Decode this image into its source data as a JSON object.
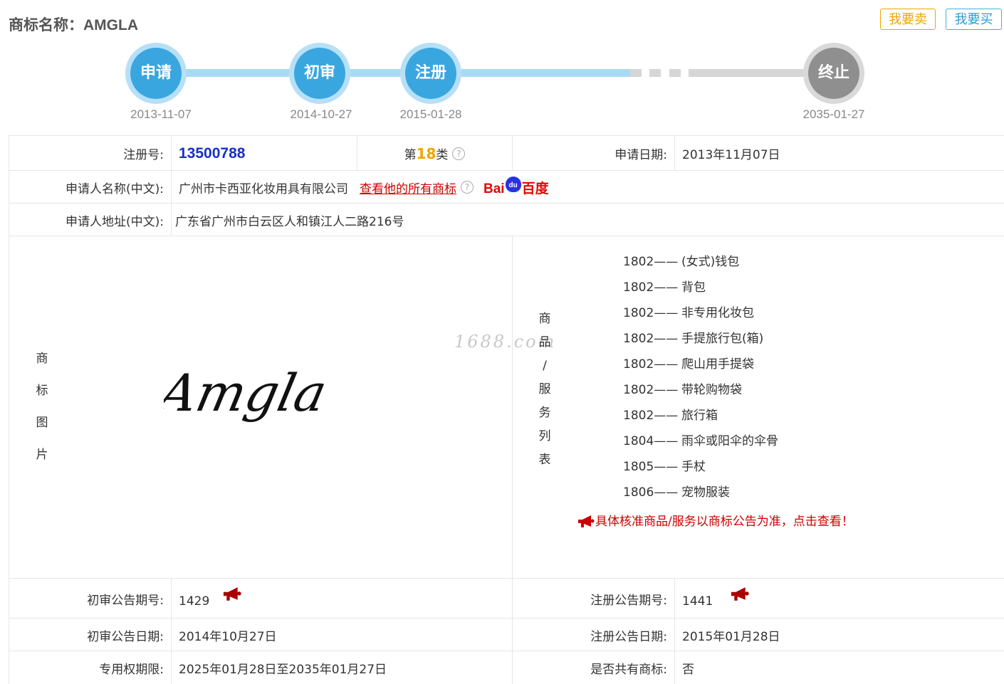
{
  "header": {
    "title": "商标名称：AMGLA",
    "sell_button": "我要卖",
    "buy_button": "我要买"
  },
  "timeline": [
    {
      "label": "申请",
      "date": "2013-11-07",
      "state": "done"
    },
    {
      "label": "初审",
      "date": "2014-10-27",
      "state": "done"
    },
    {
      "label": "注册",
      "date": "2015-01-28",
      "state": "done"
    },
    {
      "label": "终止",
      "date": "2035-01-27",
      "state": "pending"
    }
  ],
  "details": {
    "reg_no_label": "注册号:",
    "reg_no": "13500788",
    "class_prefix": "第",
    "class_num": "18",
    "class_suffix": "类",
    "apply_date_label": "申请日期:",
    "apply_date": "2013年11月07日",
    "applicant_label": "申请人名称(中文):",
    "applicant": "广州市卡西亚化妆用具有限公司",
    "all_marks_link": "查看他的所有商标",
    "baidu_logo": "Bai百度",
    "address_label": "申请人地址(中文):",
    "address": "广东省广州市白云区人和镇江人二路216号",
    "image_label": [
      "商",
      "标",
      "图",
      "片"
    ],
    "goods_label": [
      "商",
      "品",
      "/",
      "服",
      "务",
      "列",
      "表"
    ],
    "logo_text": "Amgla",
    "watermark": "1688.com",
    "prelim_no_label": "初审公告期号:",
    "prelim_no": "1429",
    "reg_pub_no_label": "注册公告期号:",
    "reg_pub_no": "1441",
    "prelim_date_label": "初审公告日期:",
    "prelim_date": "2014年10月27日",
    "reg_pub_date_label": "注册公告日期:",
    "reg_pub_date": "2015年01月28日",
    "term_label": "专用权期限:",
    "term": "2025年01月28日至2035年01月27日",
    "shared_label": "是否共有商标:",
    "shared": "否"
  },
  "goods": [
    {
      "code": "1802——",
      "name": "(女式)钱包"
    },
    {
      "code": "1802——",
      "name": "背包"
    },
    {
      "code": "1802——",
      "name": "非专用化妆包"
    },
    {
      "code": "1802——",
      "name": "手提旅行包(箱)"
    },
    {
      "code": "1802——",
      "name": "爬山用手提袋"
    },
    {
      "code": "1802——",
      "name": "带轮购物袋"
    },
    {
      "code": "1802——",
      "name": "旅行箱"
    },
    {
      "code": "1804——",
      "name": "雨伞或阳伞的伞骨"
    },
    {
      "code": "1805——",
      "name": "手杖"
    },
    {
      "code": "1806——",
      "name": "宠物服装"
    }
  ],
  "notice": "具体核准商品/服务以商标公告为准，点击查看！",
  "colors": {
    "accent_blue": "#3aa6e0",
    "sell": "#f0a500",
    "buy": "#2a9fcf",
    "link_red": "#cc0000"
  }
}
